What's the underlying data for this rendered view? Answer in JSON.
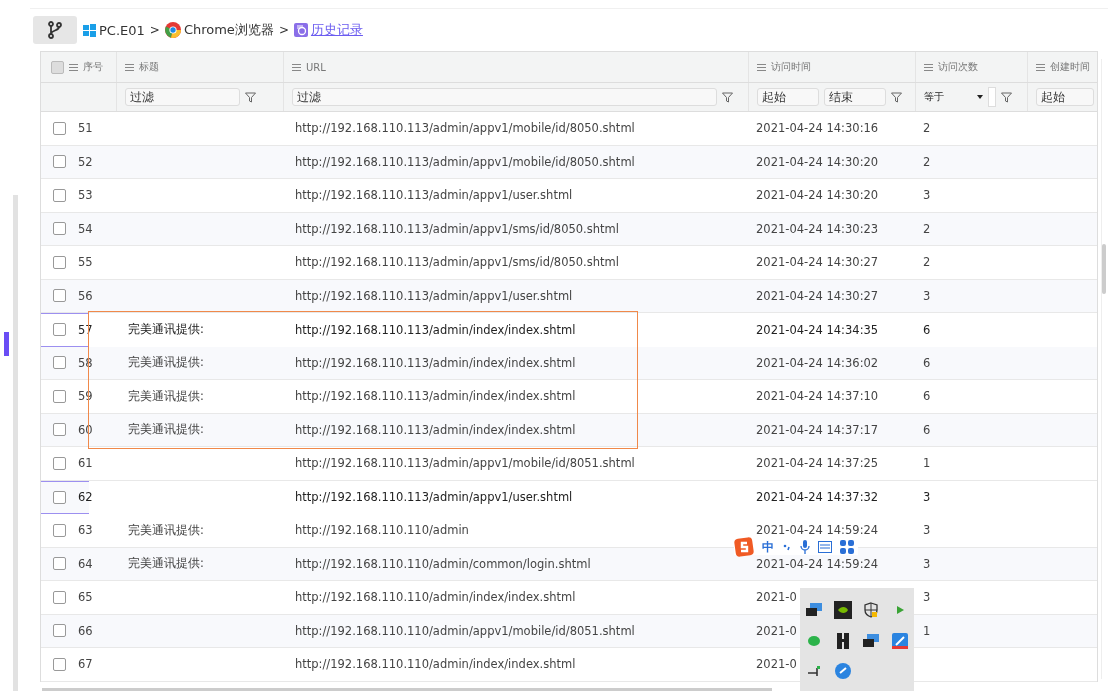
{
  "breadcrumb": [
    {
      "label": "PC.E01",
      "kind": "windows",
      "link": false
    },
    {
      "label": "Chrome浏览器",
      "kind": "chrome",
      "link": false
    },
    {
      "label": "历史记录",
      "kind": "history",
      "link": true
    }
  ],
  "separator": ">",
  "table": {
    "header_checkbox": {
      "checked": false
    },
    "columns": [
      "序号",
      "标题",
      "URL",
      "访问时间",
      "访问次数",
      "创建时间"
    ],
    "filters": {
      "title": "过滤",
      "url": "过滤",
      "time_start": "起始",
      "time_end": "结束",
      "count_op": "等于",
      "created_start": "起始"
    },
    "rows": [
      {
        "no": "51",
        "title": "",
        "url": "http://192.168.110.113/admin/appv1/mobile/id/8050.shtml",
        "time": "2021-04-24 14:30:16",
        "count": "2",
        "checked": false,
        "selected": false,
        "boxed": false
      },
      {
        "no": "52",
        "title": "",
        "url": "http://192.168.110.113/admin/appv1/mobile/id/8050.shtml",
        "time": "2021-04-24 14:30:20",
        "count": "2",
        "checked": false,
        "selected": false,
        "boxed": false
      },
      {
        "no": "53",
        "title": "",
        "url": "http://192.168.110.113/admin/appv1/user.shtml",
        "time": "2021-04-24 14:30:20",
        "count": "3",
        "checked": false,
        "selected": false,
        "boxed": false
      },
      {
        "no": "54",
        "title": "",
        "url": "http://192.168.110.113/admin/appv1/sms/id/8050.shtml",
        "time": "2021-04-24 14:30:23",
        "count": "2",
        "checked": false,
        "selected": false,
        "boxed": false
      },
      {
        "no": "55",
        "title": "",
        "url": "http://192.168.110.113/admin/appv1/sms/id/8050.shtml",
        "time": "2021-04-24 14:30:27",
        "count": "2",
        "checked": false,
        "selected": false,
        "boxed": false
      },
      {
        "no": "56",
        "title": "",
        "url": "http://192.168.110.113/admin/appv1/user.shtml",
        "time": "2021-04-24 14:30:27",
        "count": "3",
        "checked": false,
        "selected": false,
        "boxed": false
      },
      {
        "no": "57",
        "title": "完美通讯提供:",
        "url": "http://192.168.110.113/admin/index/index.shtml",
        "time": "2021-04-24 14:34:35",
        "count": "6",
        "checked": false,
        "selected": true,
        "boxed": true
      },
      {
        "no": "58",
        "title": "完美通讯提供:",
        "url": "http://192.168.110.113/admin/index/index.shtml",
        "time": "2021-04-24 14:36:02",
        "count": "6",
        "checked": false,
        "selected": false,
        "boxed": true
      },
      {
        "no": "59",
        "title": "完美通讯提供:",
        "url": "http://192.168.110.113/admin/index/index.shtml",
        "time": "2021-04-24 14:37:10",
        "count": "6",
        "checked": false,
        "selected": false,
        "boxed": true
      },
      {
        "no": "60",
        "title": "完美通讯提供:",
        "url": "http://192.168.110.113/admin/index/index.shtml",
        "time": "2021-04-24 14:37:17",
        "count": "6",
        "checked": false,
        "selected": false,
        "boxed": true
      },
      {
        "no": "61",
        "title": "",
        "url": "http://192.168.110.113/admin/appv1/mobile/id/8051.shtml",
        "time": "2021-04-24 14:37:25",
        "count": "1",
        "checked": false,
        "selected": false,
        "boxed": false
      },
      {
        "no": "62",
        "title": "",
        "url": "http://192.168.110.113/admin/appv1/user.shtml",
        "time": "2021-04-24 14:37:32",
        "count": "3",
        "checked": false,
        "selected": true,
        "boxed": false
      },
      {
        "no": "63",
        "title": "完美通讯提供:",
        "url": "http://192.168.110.110/admin",
        "time": "2021-04-24 14:59:24",
        "count": "3",
        "checked": false,
        "selected": false,
        "boxed": false
      },
      {
        "no": "64",
        "title": "完美通讯提供:",
        "url": "http://192.168.110.110/admin/common/login.shtml",
        "time": "2021-04-24 14:59:24",
        "count": "3",
        "checked": false,
        "selected": false,
        "boxed": false
      },
      {
        "no": "65",
        "title": "",
        "url": "http://192.168.110.110/admin/index/index.shtml",
        "time": "2021-0",
        "count": "3",
        "checked": false,
        "selected": false,
        "boxed": false
      },
      {
        "no": "66",
        "title": "",
        "url": "http://192.168.110.110/admin/appv1/mobile/id/8051.shtml",
        "time": "2021-0",
        "count": "1",
        "checked": false,
        "selected": false,
        "boxed": false
      },
      {
        "no": "67",
        "title": "",
        "url": "http://192.168.110.110/admin/index/index.shtml",
        "time": "2021-0",
        "count": "",
        "checked": false,
        "selected": false,
        "boxed": false
      }
    ]
  },
  "ime_toolbar": {
    "mode": "中"
  }
}
